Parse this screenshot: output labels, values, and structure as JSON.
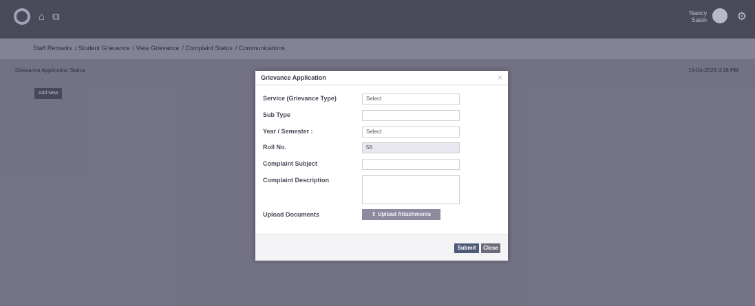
{
  "topbar": {
    "icons": [
      "app-logo-icon",
      "home-icon",
      "external-link-icon",
      "user-avatar-icon",
      "gear-icon"
    ],
    "user": "Nancy Sasin"
  },
  "breadcrumb": [
    "Staff Remarks",
    "Student Grievance",
    "View Grievance",
    "Complaint Status",
    "Communications"
  ],
  "page": {
    "heading": "Grievance Application Status",
    "date": "16-04-2023 4:18 PM",
    "add_button": "Add New"
  },
  "modal": {
    "title": "Grievance Application",
    "labels": {
      "service": "Service (Grievance Type)",
      "subtype": "Sub Type",
      "year": "Year / Semester :",
      "roll": "Roll No.",
      "subject": "Complaint Subject",
      "description": "Complaint Description",
      "upload": "Upload Documents"
    },
    "fields": {
      "service_value": "Select",
      "subtype_value": "",
      "year_value": "Select",
      "roll_value": "58",
      "subject_value": "",
      "description_value": ""
    },
    "upload_button": "Upload Attachments",
    "submit_button": "Submit",
    "close_button": "Close"
  },
  "colors": {
    "topbar": "#4c4c5c",
    "breadcrumb_bar": "#8f8ea0",
    "content_bg": "#7c7a8e",
    "submit": "#4e5b78"
  }
}
